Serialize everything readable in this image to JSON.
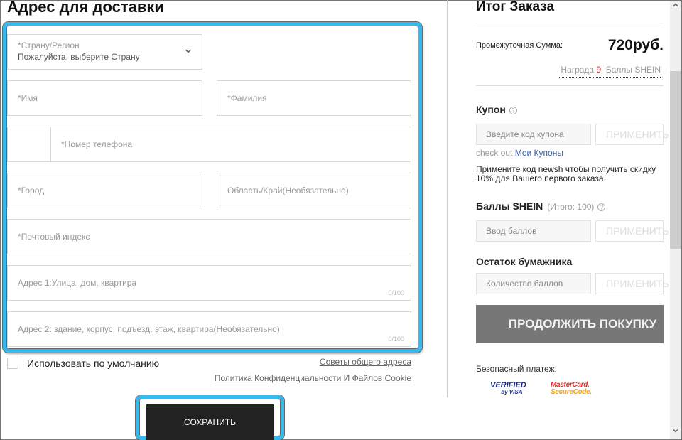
{
  "address_form": {
    "title": "Адрес для доставки",
    "country": {
      "label": "*Страну/Регион",
      "value": "Пожалуйста, выберите Страну"
    },
    "first_name": {
      "placeholder": "*Имя"
    },
    "last_name": {
      "placeholder": "*Фамилия"
    },
    "phone": {
      "prefix": "",
      "placeholder": "*Номер телефона"
    },
    "city": {
      "placeholder": "*Город"
    },
    "region": {
      "placeholder": "Область/Край(Необязательно)"
    },
    "postcode": {
      "placeholder": "*Почтовый индекс"
    },
    "address1": {
      "placeholder": "Адрес 1:Улица, дом, квартира",
      "counter": "0/100"
    },
    "address2": {
      "placeholder": "Адрес 2: здание, корпус, подъезд, этаж, квартира(Необязательно)",
      "counter": "0/100"
    },
    "default_checkbox": {
      "label": "Использовать по умолчанию",
      "checked": false
    },
    "tips_link": "Советы общего адреса",
    "privacy_link": "Политика Конфиденциальности И Файлов Cookie",
    "save_button": "СОХРАНИТЬ"
  },
  "order_summary": {
    "title": "Итог Заказа",
    "subtotal_label": "Промежуточная Сумма:",
    "subtotal_value": "720руб.",
    "reward_prefix": "Награда",
    "reward_points": "9",
    "reward_suffix": "Баллы SHEIN",
    "coupon": {
      "title": "Купон",
      "help": "?",
      "placeholder": "Введите код купона",
      "apply": "ПРИМЕНИТЬ",
      "checkout_prefix": "check out",
      "my_coupons_link": "Мои Купоны",
      "promo_text": "Примените код newsh чтобы получить скидку 10% для Вашего первого заказа."
    },
    "points": {
      "title": "Баллы SHEIN",
      "total": "(Итого: 100)",
      "help": "?",
      "placeholder": "Ввод баллов",
      "apply": "ПРИМЕНИТЬ"
    },
    "wallet": {
      "title": "Остаток бумажника",
      "placeholder": "Количество баллов",
      "apply": "ПРИМЕНИТЬ"
    },
    "continue_button": "ПРОДОЛЖИТЬ ПОКУПКУ",
    "secure_payment_label": "Безопасный платеж:",
    "badges": {
      "visa_line1": "VERIFIED",
      "visa_line2": "by VISA",
      "mc_line1": "MasterCard.",
      "mc_line2": "SecureCode."
    }
  },
  "scrollbar": {
    "up": "⌃",
    "down": "⌄"
  },
  "colors": {
    "highlight": "#36b9ee",
    "reward_number": "#e23a3a",
    "link_blue": "#3a5fa0",
    "save_bg": "#222222",
    "continue_bg": "#777777"
  }
}
